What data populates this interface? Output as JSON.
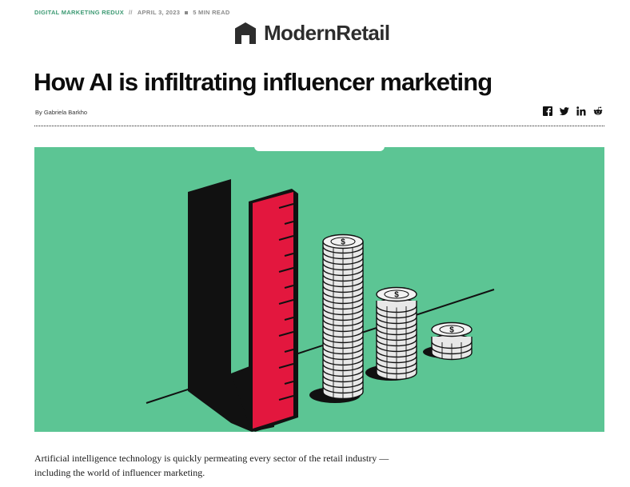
{
  "article": {
    "category": "DIGITAL MARKETING REDUX",
    "separator": "//",
    "date": "APRIL 3, 2023",
    "read_time": "5 MIN READ",
    "title": "How AI is infiltrating influencer marketing",
    "byline": "By Gabriela Barkho",
    "dek": "Artificial intelligence technology is quickly permeating every sector of the retail industry — including the world of influencer marketing."
  },
  "brand": {
    "logo_text": "ModernRetail"
  },
  "share": {
    "icons": [
      "facebook-icon",
      "twitter-icon",
      "linkedin-icon",
      "reddit-icon"
    ]
  },
  "colors": {
    "accent_green": "#3d9a73",
    "hero_background": "#5cc594",
    "ruler_red": "#e3173e",
    "logo_gray": "#2d2d2d"
  }
}
